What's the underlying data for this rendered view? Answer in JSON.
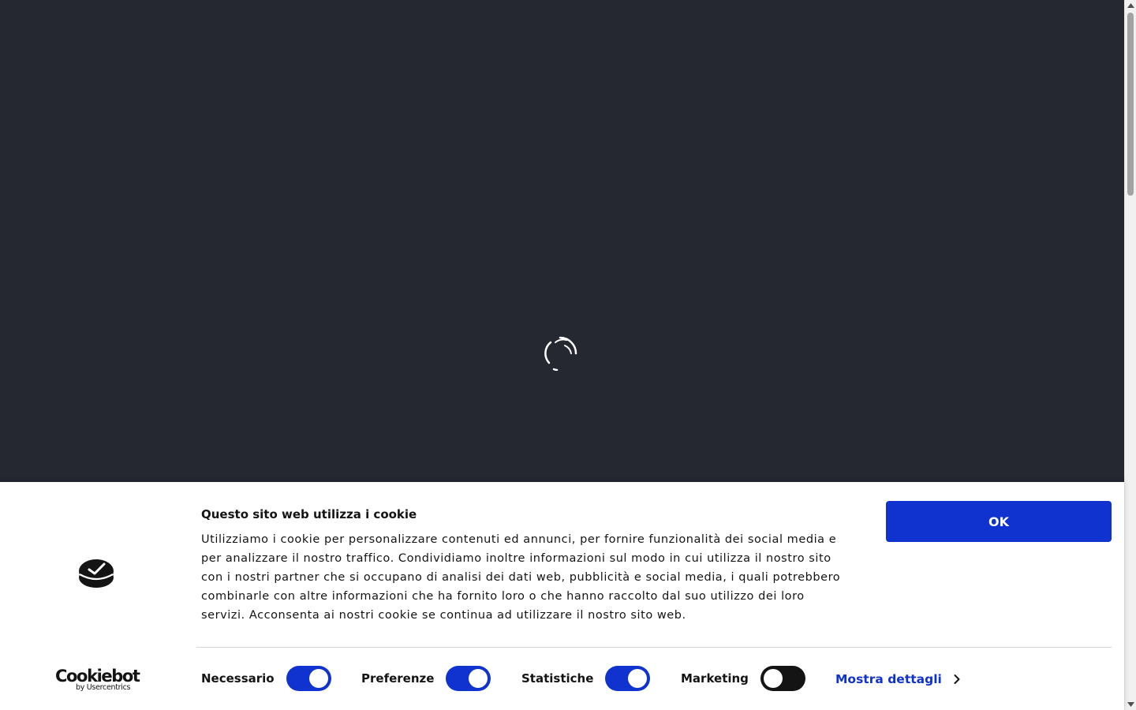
{
  "banner": {
    "title": "Questo sito web utilizza i cookie",
    "body": "Utilizziamo i cookie per personalizzare contenuti ed annunci, per fornire funzionalità dei social media e per analizzare il nostro traffico. Condividiamo inoltre informazioni sul modo in cui utilizza il nostro sito con i nostri partner che si occupano di analisi dei dati web, pubblicità e social media, i quali potrebbero combinarle con altre informazioni che ha fornito loro o che hanno raccolto dal suo utilizzo dei loro servizi. Acconsenta ai nostri cookie se continua ad utilizzare il nostro sito web.",
    "ok_label": "OK",
    "brand": {
      "name": "Cookiebot",
      "sub": "by Usercentrics"
    },
    "consents": [
      {
        "label": "Necessario",
        "checked": true
      },
      {
        "label": "Preferenze",
        "checked": true
      },
      {
        "label": "Statistiche",
        "checked": true
      },
      {
        "label": "Marketing",
        "checked": false
      }
    ],
    "details_label": "Mostra dettagli"
  },
  "colors": {
    "page_background": "#252831",
    "accent": "#1032cf",
    "toggle_off": "#141414",
    "text": "#141414"
  },
  "icons": {
    "loading": "loading-spinner-icon",
    "cookie": "cookie-icon",
    "details": "chevron-right-icon"
  }
}
